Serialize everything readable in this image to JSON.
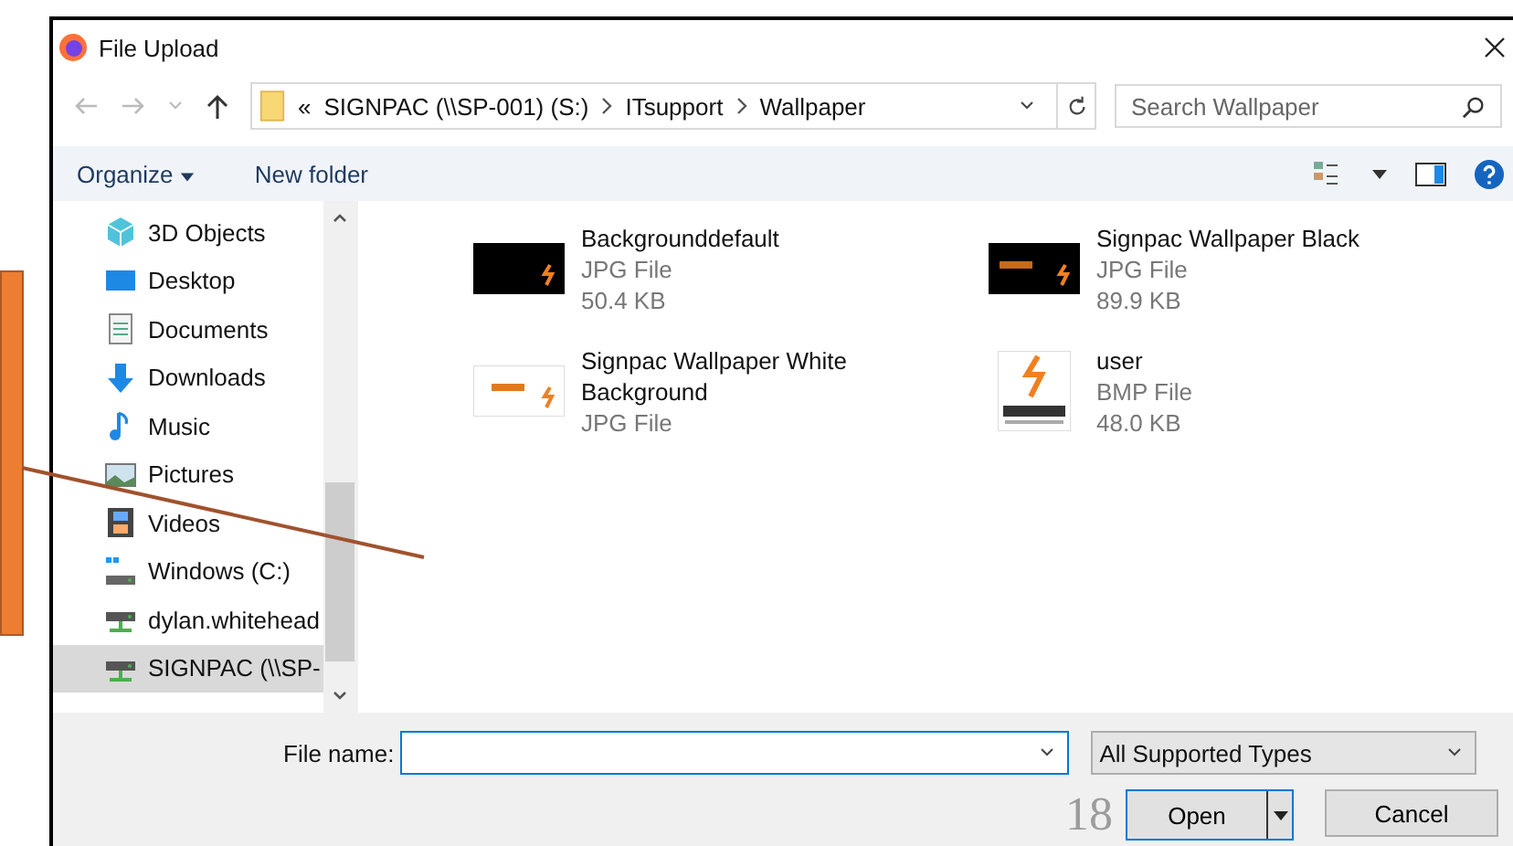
{
  "window": {
    "title": "File Upload"
  },
  "address": {
    "overflow_marker": "«",
    "path": [
      "SIGNPAC (\\\\SP-001) (S:)",
      "ITsupport",
      "Wallpaper"
    ]
  },
  "search": {
    "placeholder": "Search Wallpaper"
  },
  "toolbar": {
    "organize": "Organize",
    "new_folder": "New folder"
  },
  "sidebar": {
    "items": [
      {
        "label": "3D Objects",
        "kind": "cube",
        "selected": false
      },
      {
        "label": "Desktop",
        "kind": "desktop",
        "selected": false
      },
      {
        "label": "Documents",
        "kind": "document",
        "selected": false
      },
      {
        "label": "Downloads",
        "kind": "download",
        "selected": false
      },
      {
        "label": "Music",
        "kind": "music",
        "selected": false
      },
      {
        "label": "Pictures",
        "kind": "picture",
        "selected": false
      },
      {
        "label": "Videos",
        "kind": "film",
        "selected": false
      },
      {
        "label": "Windows (C:)",
        "kind": "drive",
        "selected": false
      },
      {
        "label": "dylan.whitehead",
        "kind": "netdrive",
        "selected": false
      },
      {
        "label": "SIGNPAC (\\\\SP-",
        "kind": "netdrive",
        "selected": true
      }
    ]
  },
  "files": [
    {
      "name": "Backgrounddefault",
      "details": [
        "JPG File",
        "50.4 KB"
      ],
      "kind": "dark"
    },
    {
      "name": "Signpac Wallpaper Black",
      "details": [
        "JPG File",
        "89.9 KB"
      ],
      "kind": "dark-logo"
    },
    {
      "name": "Signpac Wallpaper White Background",
      "details": [
        "JPG File"
      ],
      "kind": "light-logo"
    },
    {
      "name": "user",
      "details": [
        "BMP File",
        "48.0 KB"
      ],
      "kind": "logo"
    }
  ],
  "file_name": {
    "label": "File name:"
  },
  "file_type": {
    "value": "All Supported Types"
  },
  "buttons": {
    "open": "Open",
    "cancel": "Cancel"
  },
  "slide": {
    "page_number": "18"
  }
}
